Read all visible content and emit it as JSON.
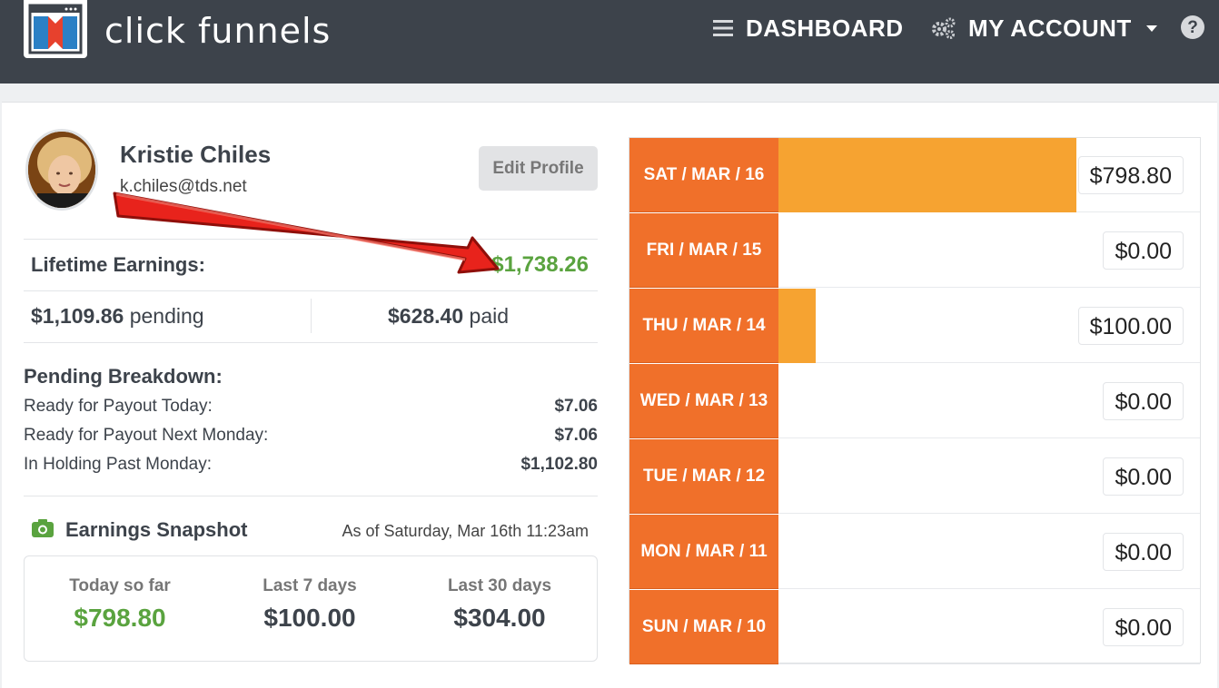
{
  "header": {
    "brand": "click funnels",
    "nav": {
      "dashboard": "DASHBOARD",
      "account": "MY ACCOUNT",
      "help": "?"
    },
    "icons": {
      "menu": "hamburger-icon",
      "account": "gears-icon",
      "help": "question-icon"
    }
  },
  "profile": {
    "name": "Kristie Chiles",
    "email": "k.chiles@tds.net",
    "id_prefix": "#",
    "edit_label": "Edit Profile"
  },
  "earnings": {
    "lifetime_label": "Lifetime Earnings:",
    "lifetime_value": "$1,738.26",
    "pending_value": "$1,109.86",
    "pending_word": "pending",
    "paid_value": "$628.40",
    "paid_word": "paid"
  },
  "breakdown": {
    "title": "Pending Breakdown:",
    "rows": [
      {
        "label": "Ready for Payout Today:",
        "value": "$7.06"
      },
      {
        "label": "Ready for Payout Next Monday:",
        "value": "$7.06"
      },
      {
        "label": "In Holding Past Monday:",
        "value": "$1,102.80"
      }
    ]
  },
  "snapshot": {
    "title": "Earnings Snapshot",
    "as_of": "As of Saturday, Mar 16th 11:23am",
    "cols": [
      {
        "label": "Today so far",
        "value": "$798.80"
      },
      {
        "label": "Last 7 days",
        "value": "$100.00"
      },
      {
        "label": "Last 30 days",
        "value": "$304.00"
      }
    ]
  },
  "days": [
    {
      "label": "SAT / MAR / 16",
      "value": "$798.80",
      "amount": 798.8
    },
    {
      "label": "FRI / MAR / 15",
      "value": "$0.00",
      "amount": 0
    },
    {
      "label": "THU / MAR / 14",
      "value": "$100.00",
      "amount": 100.0
    },
    {
      "label": "WED / MAR / 13",
      "value": "$0.00",
      "amount": 0
    },
    {
      "label": "TUE / MAR / 12",
      "value": "$0.00",
      "amount": 0
    },
    {
      "label": "MON / MAR / 11",
      "value": "$0.00",
      "amount": 0
    },
    {
      "label": "SUN / MAR / 10",
      "value": "$0.00",
      "amount": 0
    }
  ],
  "colors": {
    "nav_bg": "#3d434b",
    "day_label": "#f0702a",
    "day_bar": "#f6a331",
    "green": "#5aa33f",
    "arrow": "#e8231c"
  }
}
